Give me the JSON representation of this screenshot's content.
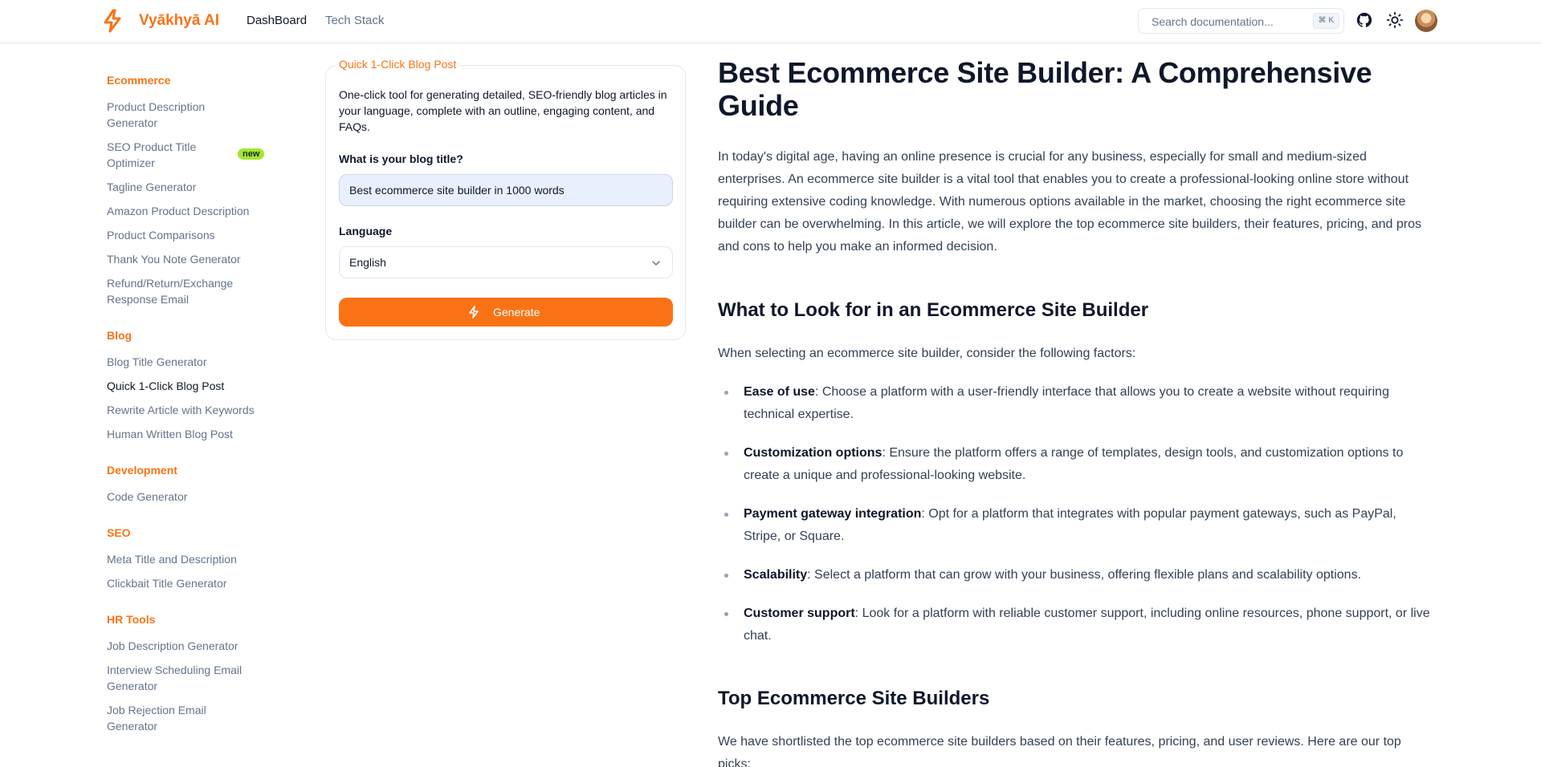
{
  "header": {
    "brand": "Vyākhyā AI",
    "nav": [
      "DashBoard",
      "Tech Stack"
    ],
    "search_placeholder": "Search documentation...",
    "search_shortcut": "⌘ K",
    "icons": [
      "github-icon",
      "sun-icon"
    ],
    "accent_color": "#f97316"
  },
  "sidebar": {
    "sections": [
      {
        "title": "Ecommerce",
        "items": [
          "Product Description Generator",
          "SEO Product Title Optimizer",
          "Tagline Generator",
          "Amazon Product Description",
          "Product Comparisons",
          "Thank You Note Generator",
          "Refund/Return/Exchange Response Email"
        ]
      },
      {
        "title": "Blog",
        "items": [
          "Blog Title Generator",
          "Quick 1-Click Blog Post",
          "Rewrite Article with Keywords",
          "Human Written Blog Post"
        ]
      },
      {
        "title": "Development",
        "items": [
          "Code Generator"
        ]
      },
      {
        "title": "SEO",
        "items": [
          "Meta Title and Description",
          "Clickbait Title Generator"
        ]
      },
      {
        "title": "HR Tools",
        "items": [
          "Job Description Generator",
          "Interview Scheduling Email Generator",
          "Job Rejection Email Generator"
        ]
      }
    ],
    "new_badge": "new",
    "active_item": "Quick 1-Click Blog Post"
  },
  "tool": {
    "legend": "Quick 1-Click Blog Post",
    "description": "One-click tool for generating detailed, SEO-friendly blog articles in your language, complete with an outline, engaging content, and FAQs.",
    "title_label": "What is your blog title?",
    "title_value": "Best ecommerce site builder in 1000 words",
    "language_label": "Language",
    "language_value": "English",
    "generate_label": "Generate"
  },
  "article": {
    "title": "Best Ecommerce Site Builder: A Comprehensive Guide",
    "intro": "In today's digital age, having an online presence is crucial for any business, especially for small and medium-sized enterprises. An ecommerce site builder is a vital tool that enables you to create a professional-looking online store without requiring extensive coding knowledge. With numerous options available in the market, choosing the right ecommerce site builder can be overwhelming. In this article, we will explore the top ecommerce site builders, their features, pricing, and pros and cons to help you make an informed decision.",
    "h2_1": "What to Look for in an Ecommerce Site Builder",
    "p2": "When selecting an ecommerce site builder, consider the following factors:",
    "bullets": [
      {
        "term": "Ease of use",
        "text": ": Choose a platform with a user-friendly interface that allows you to create a website without requiring technical expertise."
      },
      {
        "term": "Customization options",
        "text": ": Ensure the platform offers a range of templates, design tools, and customization options to create a unique and professional-looking website."
      },
      {
        "term": "Payment gateway integration",
        "text": ": Opt for a platform that integrates with popular payment gateways, such as PayPal, Stripe, or Square."
      },
      {
        "term": "Scalability",
        "text": ": Select a platform that can grow with your business, offering flexible plans and scalability options."
      },
      {
        "term": "Customer support",
        "text": ": Look for a platform with reliable customer support, including online resources, phone support, or live chat."
      }
    ],
    "h2_2": "Top Ecommerce Site Builders",
    "p3": "We have shortlisted the top ecommerce site builders based on their features, pricing, and user reviews. Here are our top picks:"
  }
}
